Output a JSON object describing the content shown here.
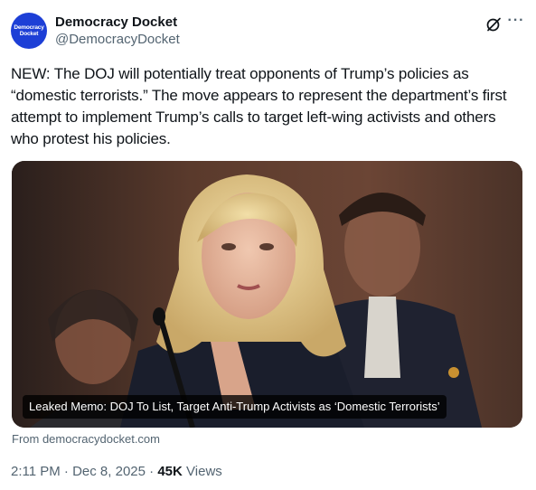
{
  "author": {
    "display_name": "Democracy Docket",
    "handle": "@DemocracyDocket",
    "avatar_text_line1": "Democracy",
    "avatar_text_line2": "Docket",
    "avatar_color": "#1d3fd6"
  },
  "icons": {
    "grok": "grok-icon",
    "more": "more-icon"
  },
  "tweet": {
    "text": "NEW: The DOJ will potentially treat opponents of Trump’s policies as “domestic terrorists.” The move appears to represent the department’s first attempt to implement Trump’s calls to target left-wing activists and others who protest his policies."
  },
  "card": {
    "caption": "Leaked Memo: DOJ To List, Target Anti-Trump Activists as ‘Domestic Terrorists’",
    "source": "From democracydocket.com"
  },
  "meta": {
    "time": "2:11 PM",
    "separator1": "·",
    "date": "Dec 8, 2025",
    "separator2": "·",
    "views_count": "45K",
    "views_label": "Views"
  },
  "colors": {
    "text": "#0f1419",
    "secondary": "#536471"
  }
}
